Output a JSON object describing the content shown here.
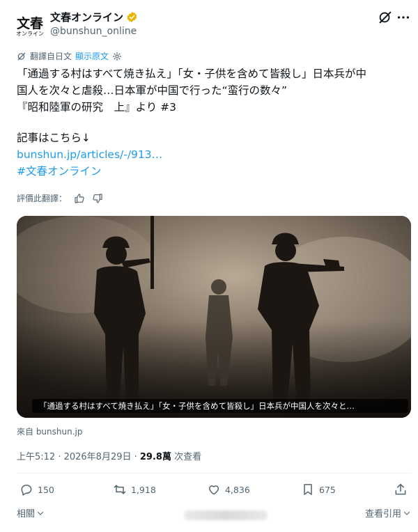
{
  "account": {
    "logo_top": "文春",
    "logo_bottom": "オンライン",
    "display_name": "文春オンライン",
    "handle": "@bunshun_online"
  },
  "header": {
    "grok_icon": "grok-icon",
    "more_icon": "more-icon"
  },
  "translation": {
    "label": "翻譯自日文",
    "show_original": "顯示原文",
    "settings_icon": "gear-icon"
  },
  "tweet": {
    "lines": [
      "「通過する村はすべて焼き払え」「女・子供を含めて皆殺し」日本兵が中",
      "国人を次々と虐殺…日本軍が中国で行った“蛮行の数々”",
      "『昭和陸軍の研究　上』より #3"
    ],
    "article_line": "記事はこちら↓",
    "link": "bunshun.jp/articles/-/913…",
    "hashtag": "#文春オンライン"
  },
  "rating": {
    "label": "評價此翻譯：",
    "up_icon": "thumbs-up-icon",
    "down_icon": "thumbs-down-icon"
  },
  "media": {
    "caption": "「通過する村はすべて焼き払え」「女・子供を含めて皆殺し」日本兵が中国人を次々と…",
    "source": "來自 bunshun.jp"
  },
  "meta": {
    "time": "上午5:12 · 2026年8月29日 · ",
    "views": "29.8萬",
    "views_label": " 次查看"
  },
  "actions": {
    "replies": "150",
    "reposts": "1,918",
    "likes": "4,836",
    "bookmarks": "675"
  },
  "footer": {
    "related": "相關",
    "quotes": "查看引用"
  },
  "colors": {
    "link": "#1d9bf0",
    "muted": "#536471",
    "text": "#0f1419",
    "verified": "#e8b400"
  }
}
